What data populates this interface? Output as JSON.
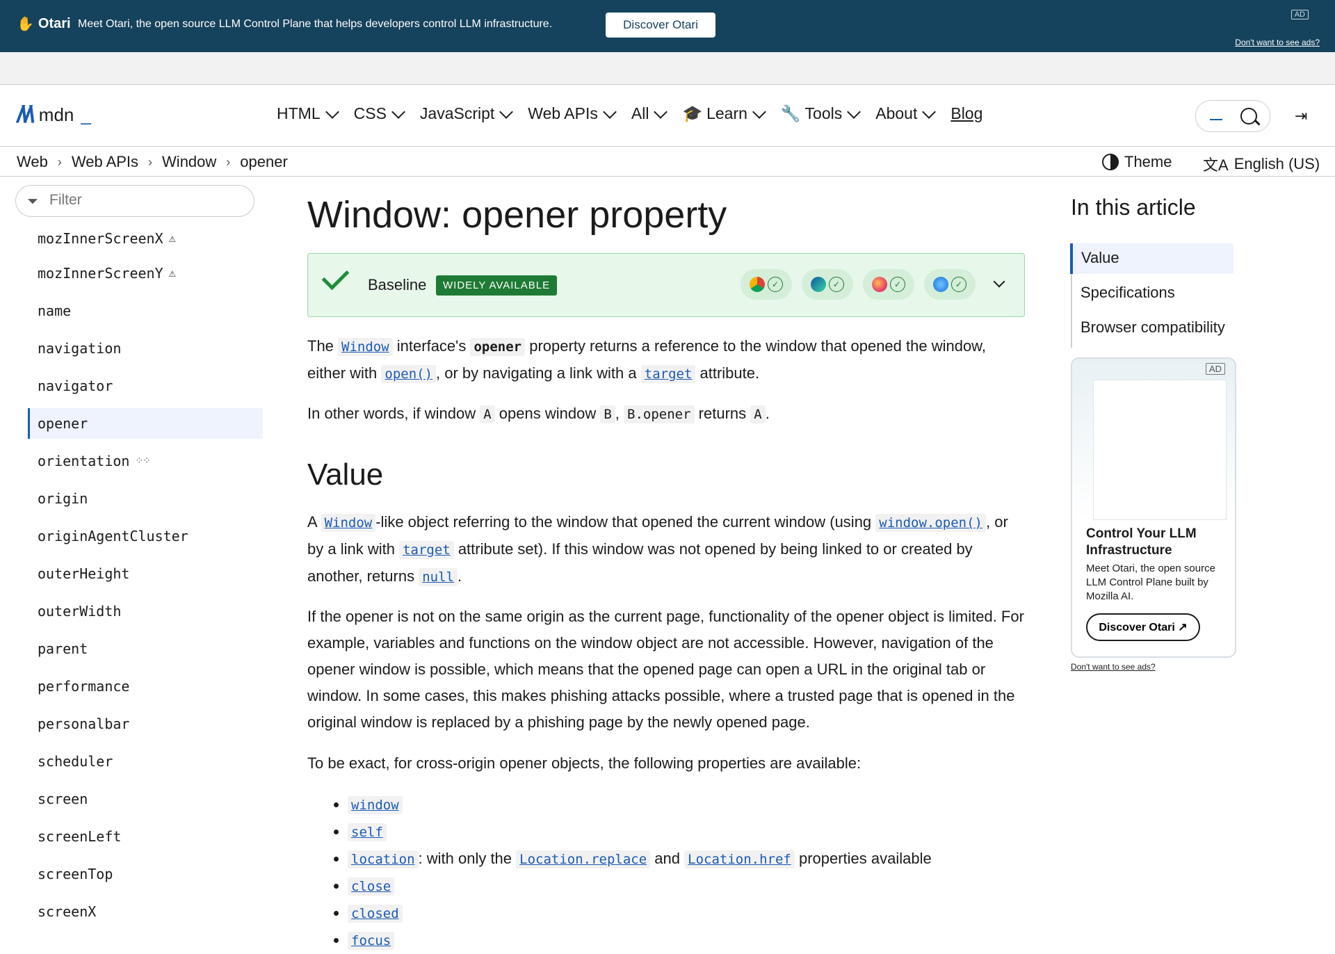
{
  "ad_banner": {
    "brand": "Otari",
    "message": "Meet Otari, the open source LLM Control Plane that helps developers control LLM infrastructure.",
    "cta": "Discover Otari",
    "tag": "AD",
    "no_ads": "Don't want to see ads?"
  },
  "header": {
    "logo_text": "mdn",
    "logo_mark": "M",
    "nav": [
      "HTML",
      "CSS",
      "JavaScript",
      "Web APIs",
      "All",
      "Learn",
      "Tools",
      "About"
    ],
    "blog": "Blog"
  },
  "breadcrumbs": [
    "Web",
    "Web APIs",
    "Window",
    "opener"
  ],
  "theme_label": "Theme",
  "language_label": "English (US)",
  "sidebar": {
    "filter_placeholder": "Filter",
    "items": [
      {
        "label": "mozInnerScreenX",
        "warn": true
      },
      {
        "label": "mozInnerScreenY",
        "warn": true
      },
      {
        "label": "name"
      },
      {
        "label": "navigation"
      },
      {
        "label": "navigator"
      },
      {
        "label": "opener",
        "active": true
      },
      {
        "label": "orientation",
        "experimental": true
      },
      {
        "label": "origin"
      },
      {
        "label": "originAgentCluster"
      },
      {
        "label": "outerHeight"
      },
      {
        "label": "outerWidth"
      },
      {
        "label": "parent"
      },
      {
        "label": "performance"
      },
      {
        "label": "personalbar"
      },
      {
        "label": "scheduler"
      },
      {
        "label": "screen"
      },
      {
        "label": "screenLeft"
      },
      {
        "label": "screenTop"
      },
      {
        "label": "screenX"
      }
    ]
  },
  "main": {
    "title": "Window: opener property",
    "baseline_label": "Baseline",
    "baseline_badge": "WIDELY AVAILABLE",
    "p1": {
      "a": "The ",
      "window": "Window",
      "b": " interface's ",
      "opener": "opener",
      "c": " property returns a reference to the window that opened the window, either with ",
      "open": "open()",
      "d": ", or by navigating a link with a ",
      "target": "target",
      "e": " attribute."
    },
    "p2": {
      "a": "In other words, if window ",
      "A": "A",
      "b": " opens window ",
      "B": "B",
      "c": ", ",
      "Bopener": "B.opener",
      "d": " returns ",
      "A2": "A",
      "e": "."
    },
    "h2_value": "Value",
    "p3": {
      "a": "A ",
      "window": "Window",
      "b": "-like object referring to the window that opened the current window (using ",
      "wopen": "window.open()",
      "c": ", or by a link with ",
      "target": "target",
      "d": " attribute set). If this window was not opened by being linked to or created by another, returns ",
      "null": "null",
      "e": "."
    },
    "p4": "If the opener is not on the same origin as the current page, functionality of the opener object is limited. For example, variables and functions on the window object are not accessible. However, navigation of the opener window is possible, which means that the opened page can open a URL in the original tab or window. In some cases, this makes phishing attacks possible, where a trusted page that is opened in the original window is replaced by a phishing page by the newly opened page.",
    "p5": "To be exact, for cross-origin opener objects, the following properties are available:",
    "list": {
      "window": "window",
      "self": "self",
      "location": "location",
      "location_text": ": with only the ",
      "replace": "Location.replace",
      "and": " and ",
      "href": "Location.href",
      "props_available": " properties available",
      "close": "close",
      "closed": "closed",
      "focus": "focus"
    }
  },
  "toc": {
    "title": "In this article",
    "items": [
      "Value",
      "Specifications",
      "Browser compatibility"
    ]
  },
  "side_ad": {
    "tag": "AD",
    "title": "Control Your LLM Infrastructure",
    "body": "Meet Otari, the open source LLM Control Plane built by Mozilla AI.",
    "cta": "Discover Otari",
    "no_ads": "Don't want to see ads?"
  }
}
